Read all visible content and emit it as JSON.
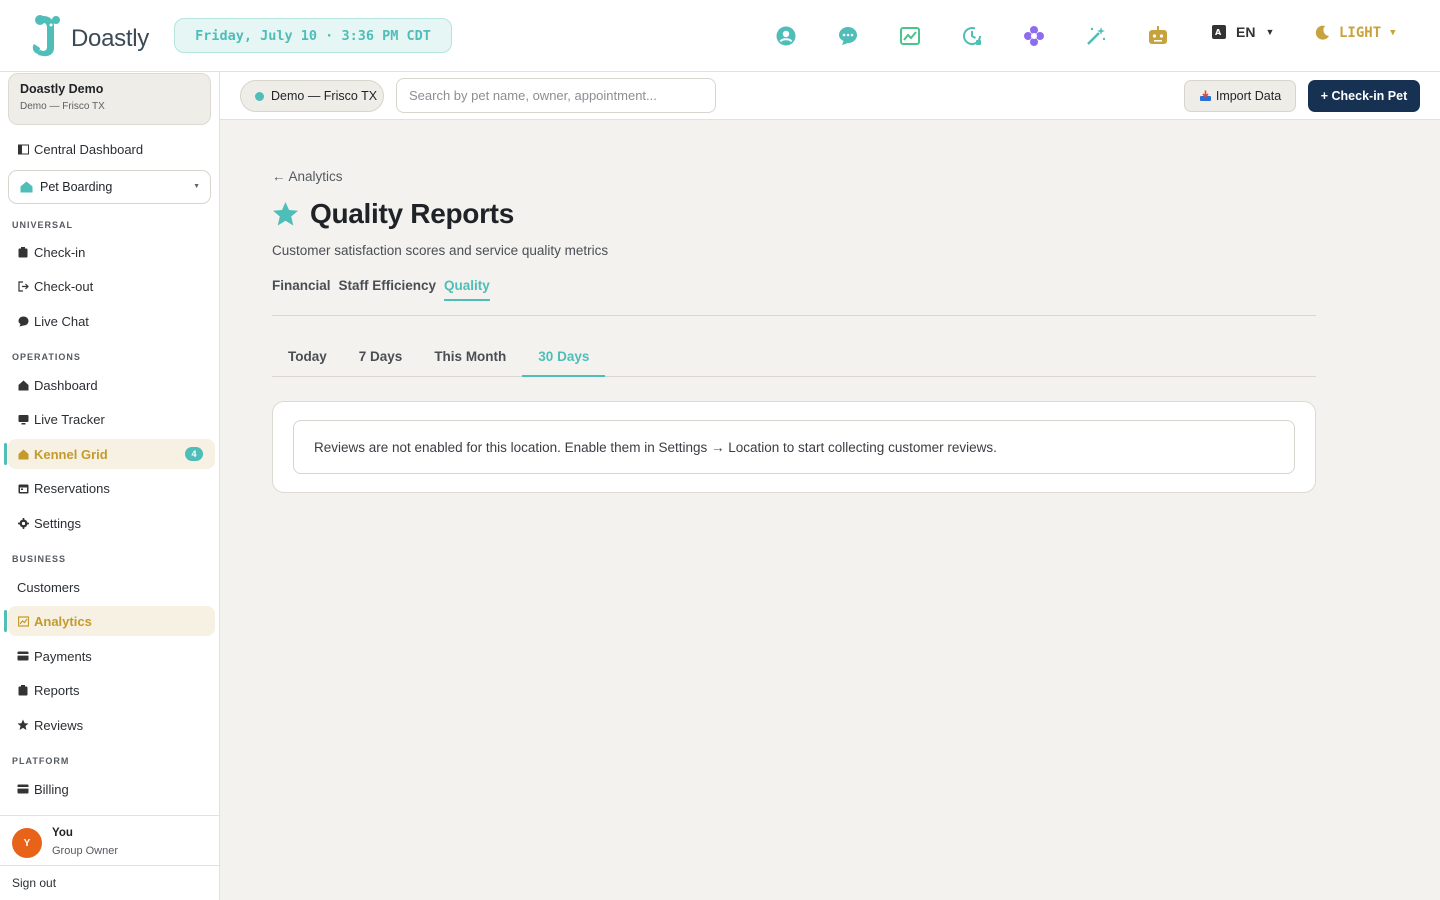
{
  "brand": {
    "name": "Doastly"
  },
  "header": {
    "datetime": "Friday, July 10 · 3:36 PM CDT",
    "language": "EN",
    "theme": "LIGHT",
    "icons": [
      "support-icon",
      "chat-icon",
      "chart-icon",
      "clock-icon",
      "flower-icon",
      "magic-wand-icon",
      "robot-icon",
      "translate-icon",
      "moon-icon"
    ],
    "colors": {
      "teal": "#4fbdb8",
      "green": "#4cc38a",
      "purple": "#8e6cf0",
      "gold": "#c8a23c",
      "navy": "#173152"
    }
  },
  "sidebar": {
    "org_name": "Doastly Demo",
    "org_location": "Demo — Frisco TX",
    "central_dashboard": "Central Dashboard",
    "business_select": "Pet Boarding",
    "sections": {
      "universal": "UNIVERSAL",
      "operations": "OPERATIONS",
      "business": "BUSINESS",
      "platform": "PLATFORM"
    },
    "items": {
      "checkin": "Check-in",
      "checkout": "Check-out",
      "live_chat": "Live Chat",
      "dashboard": "Dashboard",
      "live_tracker": "Live Tracker",
      "kennel_grid": "Kennel Grid",
      "kennel_grid_badge": "4",
      "reservations": "Reservations",
      "settings": "Settings",
      "customers": "Customers",
      "analytics": "Analytics",
      "payments": "Payments",
      "reports": "Reports",
      "reviews": "Reviews",
      "billing": "Billing"
    },
    "user": {
      "initial": "Y",
      "name": "You",
      "role": "Group Owner"
    },
    "sign_out": "Sign out"
  },
  "subbar": {
    "location": "Demo — Frisco TX",
    "search_placeholder": "Search by pet name, owner, appointment...",
    "import_label": "Import Data",
    "checkin_label": "+ Check-in Pet"
  },
  "main": {
    "back_link": "← Analytics",
    "title": "Quality Reports",
    "description": "Customer satisfaction scores and service quality metrics",
    "report_tabs": [
      "Financial",
      "Staff Efficiency",
      "Quality"
    ],
    "active_report_tab": "Quality",
    "range_tabs": [
      "Today",
      "7 Days",
      "This Month",
      "30 Days"
    ],
    "active_range_tab": "30 Days",
    "notice": "Reviews are not enabled for this location. Enable them in Settings → Location to start collecting customer reviews."
  }
}
